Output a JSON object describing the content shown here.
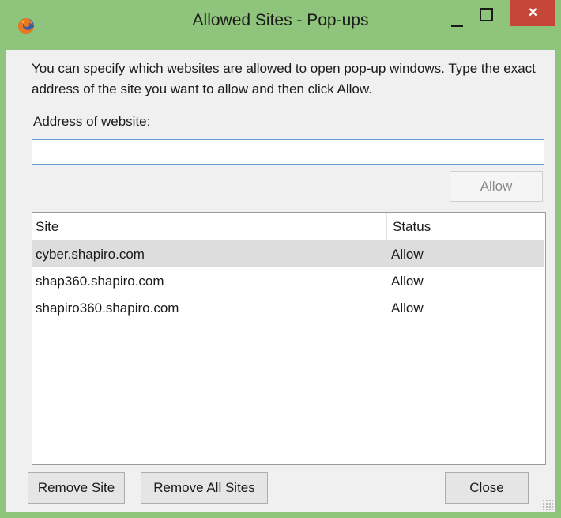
{
  "window": {
    "title": "Allowed Sites - Pop-ups",
    "app_icon": "firefox-icon",
    "controls": {
      "minimize": "minimize-icon",
      "maximize": "maximize-icon",
      "close": "×"
    },
    "colors": {
      "titlebar": "#8ec47c",
      "close_button": "#c7463a",
      "body": "#f0f0f0"
    }
  },
  "description": "You can specify which websites are allowed to open pop-up windows. Type the exact address of the site you want to allow and then click Allow.",
  "address": {
    "label": "Address of website:",
    "value": "",
    "placeholder": ""
  },
  "allow_button": {
    "label": "Allow",
    "enabled": false
  },
  "sites_list": {
    "columns": {
      "site": "Site",
      "status": "Status"
    },
    "rows": [
      {
        "site": "cyber.shapiro.com",
        "status": "Allow",
        "selected": true
      },
      {
        "site": "shap360.shapiro.com",
        "status": "Allow",
        "selected": false
      },
      {
        "site": "shapiro360.shapiro.com",
        "status": "Allow",
        "selected": false
      }
    ]
  },
  "buttons": {
    "remove_site": "Remove Site",
    "remove_all_sites": "Remove All Sites",
    "close": "Close"
  }
}
